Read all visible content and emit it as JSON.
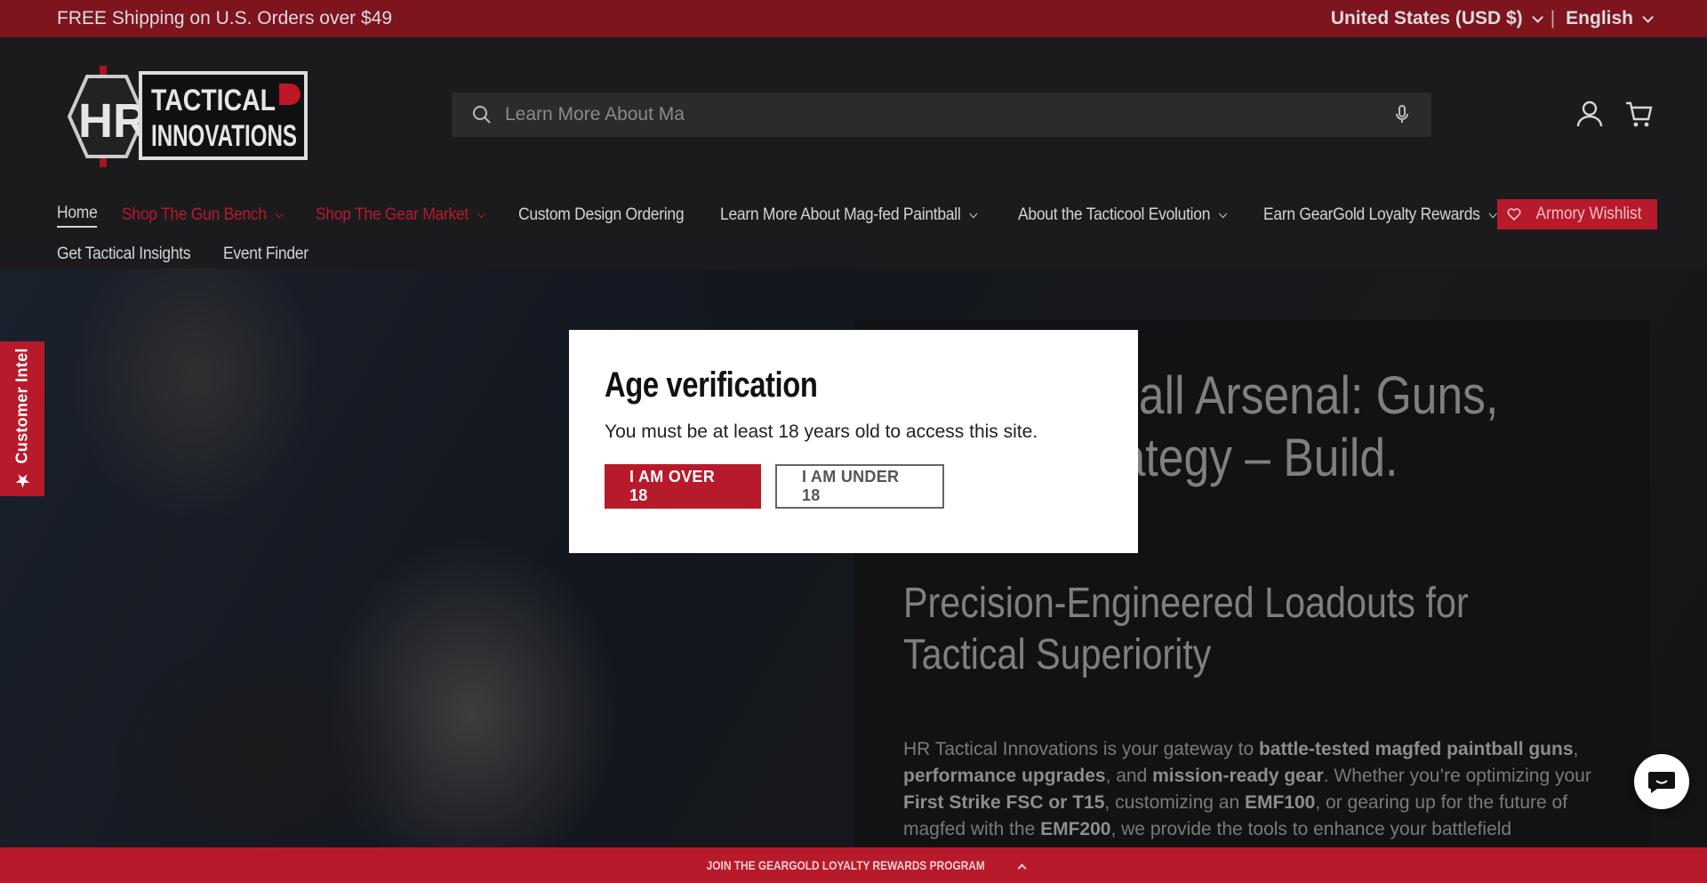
{
  "announcement": {
    "text": "FREE Shipping on U.S. Orders over $49",
    "country": "United States (USD $)",
    "separator": "|",
    "language": "English"
  },
  "header": {
    "logo_text": "HR TACTICAL INNOVATIONS",
    "search_placeholder": "Learn More About Ma",
    "icons": [
      "search-icon",
      "microphone-icon",
      "account-icon",
      "cart-icon"
    ]
  },
  "nav": {
    "row1": [
      {
        "label": "Home",
        "active": true
      },
      {
        "label": "Shop The Gun Bench",
        "dropdown": true,
        "accent": true
      },
      {
        "label": "Shop The Gear Market",
        "dropdown": true,
        "accent": true
      },
      {
        "label": "Custom Design Ordering"
      },
      {
        "label": "Learn More About Mag-fed Paintball",
        "dropdown": true
      },
      {
        "label": "About the Tacticool Evolution",
        "dropdown": true
      },
      {
        "label": "Earn GearGold Loyalty Rewards",
        "dropdown": true
      }
    ],
    "row2": [
      {
        "label": "Get Tactical Insights"
      },
      {
        "label": "Event Finder"
      }
    ],
    "wishlist": "Armory Wishlist"
  },
  "hero": {
    "title": "Your Paintball Arsenal: Guns, Gear & Strategy – Build. Upgrade.",
    "subtitle": "Precision-Engineered Loadouts for Tactical Superiority",
    "body": {
      "p1": "HR Tactical Innovations is your gateway to ",
      "b1": "battle-tested magfed paintball guns",
      "p2": ", ",
      "b2": "performance upgrades",
      "p3": ", and ",
      "b3": "mission-ready gear",
      "p4": ". Whether you’re optimizing your ",
      "b4": "First Strike FSC or T15",
      "p5": ", customizing an ",
      "b5": "EMF100",
      "p6": ", or gearing up for the future of magfed with the ",
      "b6": "EMF200",
      "p7": ", we provide the tools to enhance your battlefield dominance."
    }
  },
  "side_tab": {
    "label": "Customer Intel"
  },
  "bottom_bar": {
    "label": "JOIN THE GEARGOLD LOYALTY REWARDS PROGRAM"
  },
  "modal": {
    "title": "Age verification",
    "message": "You must be at least 18 years old to access this site.",
    "confirm_label": "I AM OVER 18",
    "deny_label": "I AM UNDER 18"
  },
  "colors": {
    "brand_red": "#b71a2a",
    "announce_bg": "#7d141e",
    "header_bg": "#1b1b1d"
  }
}
